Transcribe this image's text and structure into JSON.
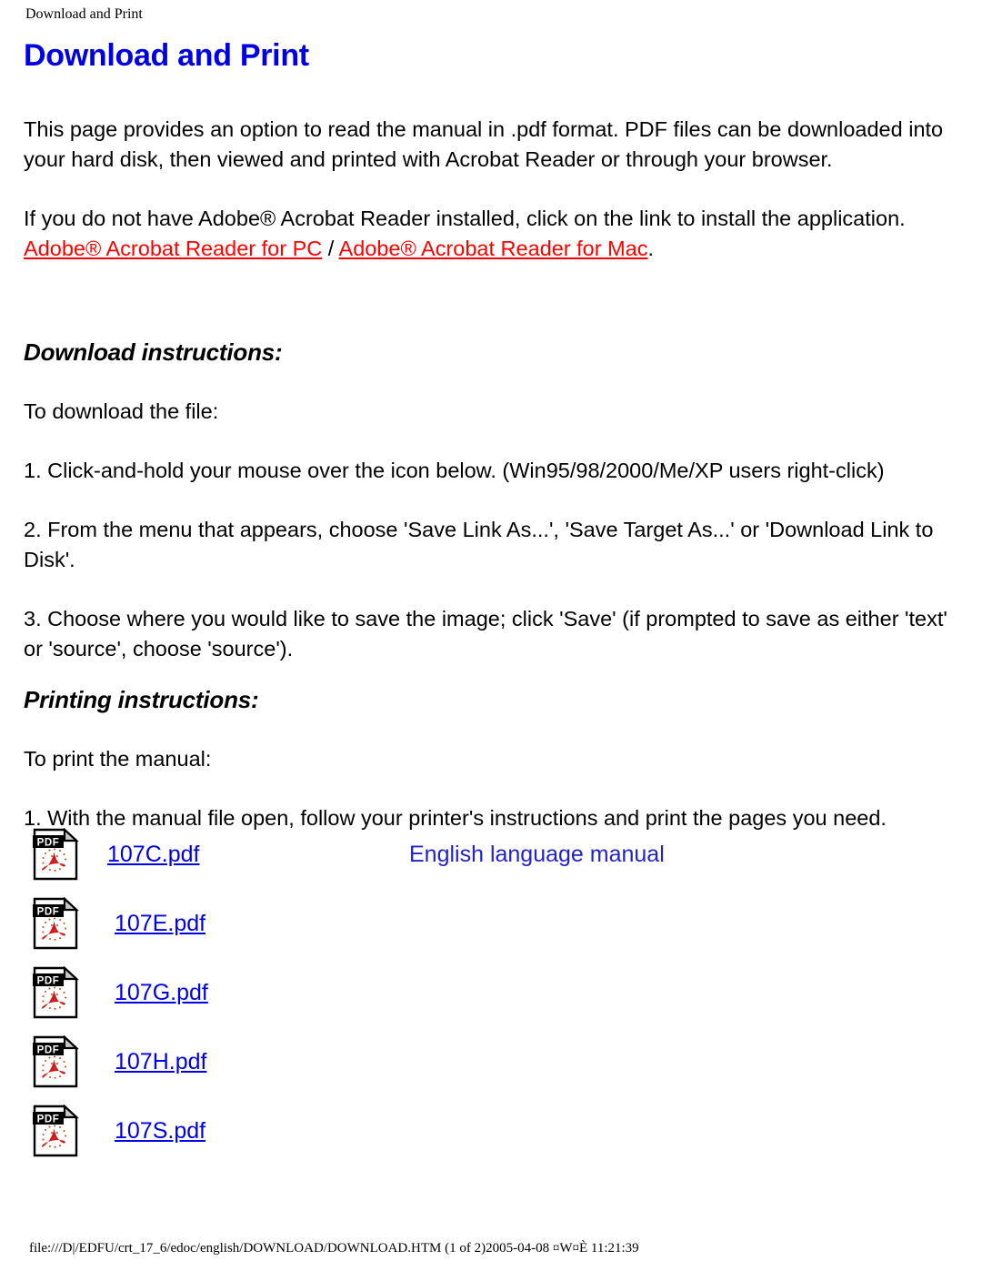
{
  "header": {
    "running_title": "Download and Print"
  },
  "document": {
    "title": "Download and Print",
    "intro_paragraph": "This page provides an option to read the manual in .pdf format. PDF files can be downloaded into your hard disk, then viewed and printed with Acrobat Reader or through your browser.",
    "acrobat_paragraph": "If you do not have Adobe® Acrobat Reader installed, click on the link to install the application.",
    "link_pc": "Adobe® Acrobat Reader for PC",
    "link_separator": " / ",
    "link_mac": "Adobe® Acrobat Reader for Mac",
    "link_trailing": "."
  },
  "download_section": {
    "heading": "Download instructions:",
    "lead": "To download the file:",
    "steps": [
      "1. Click-and-hold your mouse over the icon below. (Win95/98/2000/Me/XP users right-click)",
      "2. From the menu that appears, choose 'Save Link As...', 'Save Target As...' or 'Download Link to Disk'.",
      "3. Choose where you would like to save the image; click 'Save' (if prompted to save as either 'text' or 'source', choose 'source')."
    ]
  },
  "printing_section": {
    "heading": "Printing instructions:",
    "lead": "To print the manual:",
    "steps": [
      "1. With the manual file open, follow your printer's instructions and print the pages you need."
    ]
  },
  "pdf_files": [
    {
      "icon": "pdf-file-icon",
      "label": "107C.pdf ",
      "description": "English language manual",
      "indent": 118
    },
    {
      "icon": "pdf-file-icon",
      "label": "107E.pdf ",
      "description": "",
      "indent": 126
    },
    {
      "icon": "pdf-file-icon",
      "label": "107G.pdf ",
      "description": "",
      "indent": 126
    },
    {
      "icon": "pdf-file-icon",
      "label": "107H.pdf ",
      "description": "",
      "indent": 126
    },
    {
      "icon": "pdf-file-icon",
      "label": "107S.pdf ",
      "description": "",
      "indent": 126
    }
  ],
  "footer": {
    "path_text": "file:///D|/EDFU/crt_17_6/edoc/english/DOWNLOAD/DOWNLOAD.HTM (1 of 2)2005-04-08 ¤W¤È 11:21:39"
  },
  "colors": {
    "title_blue": "#0000E6",
    "link_red": "#FF0000",
    "link_blue": "#0000E6",
    "text_black": "#000000",
    "pdf_red": "#D2161C"
  }
}
